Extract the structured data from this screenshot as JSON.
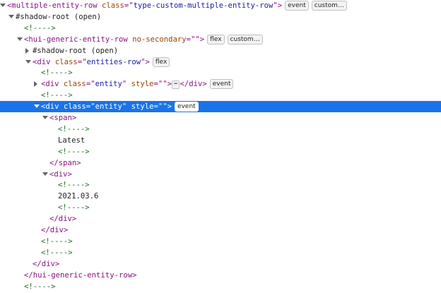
{
  "colors": {
    "tag": "#881280",
    "attr_name": "#994500",
    "attr_value": "#1a1aa6",
    "comment": "#236e25",
    "selection": "#1a73e8"
  },
  "rows": [
    {
      "expand": "open",
      "parts": [
        [
          "punct",
          "<"
        ],
        [
          "tag",
          "multiple-entity-row"
        ],
        [
          "plain",
          " "
        ],
        [
          "attr",
          "class"
        ],
        [
          "punct",
          "=\""
        ],
        [
          "val",
          "type-custom-multiple-entity-row"
        ],
        [
          "punct",
          "\">"
        ]
      ],
      "badges": [
        "event",
        "custom…"
      ]
    },
    {
      "expand": "open",
      "parts": [
        [
          "plain",
          "#shadow-root (open)"
        ]
      ],
      "badges": []
    },
    {
      "expand": null,
      "parts": [
        [
          "comment",
          "<!---->"
        ]
      ],
      "badges": []
    },
    {
      "expand": "open",
      "parts": [
        [
          "punct",
          "<"
        ],
        [
          "tag",
          "hui-generic-entity-row"
        ],
        [
          "plain",
          " "
        ],
        [
          "attr",
          "no-secondary"
        ],
        [
          "punct",
          "=\"\">"
        ]
      ],
      "badges": [
        "flex",
        "custom…"
      ]
    },
    {
      "expand": "closed",
      "parts": [
        [
          "plain",
          "#shadow-root (open)"
        ]
      ],
      "badges": []
    },
    {
      "expand": "open",
      "parts": [
        [
          "punct",
          "<"
        ],
        [
          "tag",
          "div"
        ],
        [
          "plain",
          " "
        ],
        [
          "attr",
          "class"
        ],
        [
          "punct",
          "=\""
        ],
        [
          "val",
          "entities-row"
        ],
        [
          "punct",
          "\">"
        ]
      ],
      "badges": [
        "flex"
      ]
    },
    {
      "expand": null,
      "parts": [
        [
          "comment",
          "<!---->"
        ]
      ],
      "badges": []
    },
    {
      "expand": "closed",
      "parts": [
        [
          "punct",
          "<"
        ],
        [
          "tag",
          "div"
        ],
        [
          "plain",
          " "
        ],
        [
          "attr",
          "class"
        ],
        [
          "punct",
          "=\""
        ],
        [
          "val",
          "entity"
        ],
        [
          "punct",
          "\""
        ],
        [
          "plain",
          " "
        ],
        [
          "attr",
          "style"
        ],
        [
          "punct",
          "=\"\">"
        ]
      ],
      "ellipsis": "⋯",
      "tail": [
        [
          "punct",
          "</"
        ],
        [
          "tag",
          "div"
        ],
        [
          "punct",
          ">"
        ]
      ],
      "badges": [
        "event"
      ]
    },
    {
      "expand": null,
      "parts": [
        [
          "comment",
          "<!---->"
        ]
      ],
      "badges": []
    },
    {
      "expand": "open",
      "selected": true,
      "parts": [
        [
          "punct",
          "<"
        ],
        [
          "tag",
          "div"
        ],
        [
          "plain",
          " "
        ],
        [
          "attr",
          "class"
        ],
        [
          "punct",
          "=\""
        ],
        [
          "val",
          "entity"
        ],
        [
          "punct",
          "\""
        ],
        [
          "plain",
          " "
        ],
        [
          "attr",
          "style"
        ],
        [
          "punct",
          "=\"\">"
        ]
      ],
      "badges": [
        "event"
      ]
    },
    {
      "expand": "open",
      "parts": [
        [
          "punct",
          "<"
        ],
        [
          "tag",
          "span"
        ],
        [
          "punct",
          ">"
        ]
      ],
      "badges": []
    },
    {
      "expand": null,
      "parts": [
        [
          "comment",
          "<!---->"
        ]
      ],
      "badges": []
    },
    {
      "expand": null,
      "parts": [
        [
          "text",
          "Latest"
        ]
      ],
      "badges": []
    },
    {
      "expand": null,
      "parts": [
        [
          "comment",
          "<!---->"
        ]
      ],
      "badges": []
    },
    {
      "expand": null,
      "parts": [
        [
          "punct",
          "</"
        ],
        [
          "tag",
          "span"
        ],
        [
          "punct",
          ">"
        ]
      ],
      "badges": []
    },
    {
      "expand": "open",
      "parts": [
        [
          "punct",
          "<"
        ],
        [
          "tag",
          "div"
        ],
        [
          "punct",
          ">"
        ]
      ],
      "badges": []
    },
    {
      "expand": null,
      "parts": [
        [
          "comment",
          "<!---->"
        ]
      ],
      "badges": []
    },
    {
      "expand": null,
      "parts": [
        [
          "text",
          "2021.03.6"
        ]
      ],
      "badges": []
    },
    {
      "expand": null,
      "parts": [
        [
          "comment",
          "<!---->"
        ]
      ],
      "badges": []
    },
    {
      "expand": null,
      "parts": [
        [
          "punct",
          "</"
        ],
        [
          "tag",
          "div"
        ],
        [
          "punct",
          ">"
        ]
      ],
      "badges": []
    },
    {
      "expand": null,
      "parts": [
        [
          "punct",
          "</"
        ],
        [
          "tag",
          "div"
        ],
        [
          "punct",
          ">"
        ]
      ],
      "badges": []
    },
    {
      "expand": null,
      "parts": [
        [
          "comment",
          "<!---->"
        ]
      ],
      "badges": []
    },
    {
      "expand": null,
      "parts": [
        [
          "comment",
          "<!---->"
        ]
      ],
      "badges": []
    },
    {
      "expand": null,
      "parts": [
        [
          "punct",
          "</"
        ],
        [
          "tag",
          "div"
        ],
        [
          "punct",
          ">"
        ]
      ],
      "badges": []
    },
    {
      "expand": null,
      "parts": [
        [
          "punct",
          "</"
        ],
        [
          "tag",
          "hui-generic-entity-row"
        ],
        [
          "punct",
          ">"
        ]
      ],
      "badges": []
    },
    {
      "expand": null,
      "parts": [
        [
          "comment",
          "<!---->"
        ]
      ],
      "badges": []
    }
  ]
}
